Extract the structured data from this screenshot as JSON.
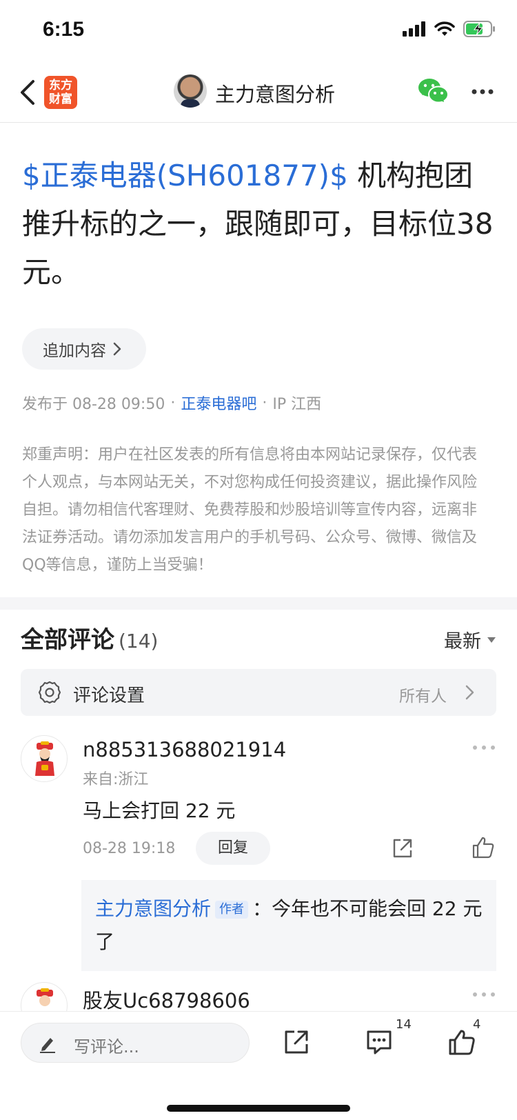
{
  "status_bar": {
    "time": "6:15"
  },
  "nav": {
    "logo_line1": "东方",
    "logo_line2": "财富",
    "title": "主力意图分析"
  },
  "post": {
    "stock_tag": "$正泰电器(SH601877)$",
    "body": " 机构抱团推升标的之一，跟随即可，目标位38元。",
    "append_label": "追加内容",
    "published": "发布于 08-28 09:50",
    "sep1": "·",
    "bar_name": "正泰电器吧",
    "sep2": "·",
    "ip": "IP 江西",
    "disclaimer": "郑重声明：用户在社区发表的所有信息将由本网站记录保存，仅代表个人观点，与本网站无关，不对您构成任何投资建议，据此操作风险自担。请勿相信代客理财、免费荐股和炒股培训等宣传内容，远离非法证券活动。请勿添加发言用户的手机号码、公众号、微博、微信及QQ等信息，谨防上当受骗！"
  },
  "comments_section": {
    "title": "全部评论",
    "count": "(14)",
    "sort_label": "最新",
    "settings_label": "评论设置",
    "settings_value": "所有人"
  },
  "comments": [
    {
      "user": "n885313688021914",
      "location": "来自:浙江",
      "text": "马上会打回 22 元",
      "time": "08-28 19:18",
      "reply_label": "回复",
      "reply": {
        "author": "主力意图分析",
        "tag": "作者",
        "colon": "：",
        "text": "今年也不可能会回 22 元了"
      }
    },
    {
      "user": "股友Uc68798606"
    }
  ],
  "bottom_bar": {
    "input_placeholder": "写评论...",
    "comment_count": "14",
    "like_count": "4"
  },
  "colors": {
    "link_blue": "#2a6dd6",
    "logo_orange": "#f0542a",
    "wechat_green": "#3bc04a"
  }
}
